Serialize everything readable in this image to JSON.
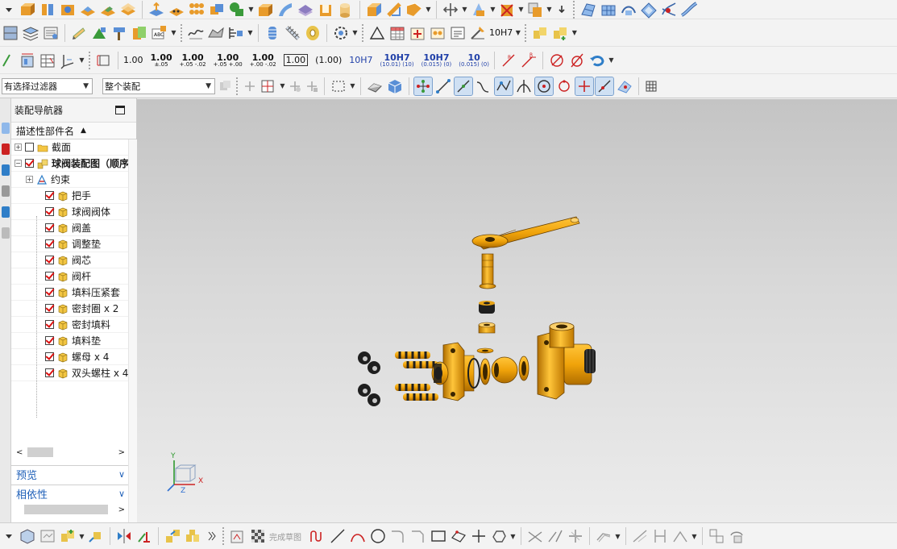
{
  "filters": {
    "selection_filter": "有选择过滤器",
    "scope": "整个装配"
  },
  "tolerances": [
    {
      "main": "1.00",
      "sub": "",
      "style": "plain"
    },
    {
      "main": "1.00",
      "sub": "±.05",
      "style": "stack"
    },
    {
      "main": "1.00",
      "sub": "+.05 -.02",
      "style": "stack"
    },
    {
      "main": "1.00",
      "sub": "+.05 +.00",
      "style": "stack"
    },
    {
      "main": "1.00",
      "sub": "+.00 -.02",
      "style": "stack"
    },
    {
      "main": "1.00",
      "sub": "",
      "style": "boxed"
    },
    {
      "main": "(1.00)",
      "sub": "",
      "style": "plain"
    },
    {
      "main": "10H7",
      "sub": "",
      "style": "blue"
    },
    {
      "main": "10H7",
      "sub": "(10.01) (10)",
      "style": "bluestack"
    },
    {
      "main": "10H7",
      "sub": "(0.015) (0)",
      "style": "bluestack"
    },
    {
      "main": "10",
      "sub": "(0.015) (0)",
      "style": "bluestack"
    }
  ],
  "fit_dropdown_label": "10H7",
  "navigator": {
    "title": "装配导航器",
    "column_header": "描述性部件名",
    "nodes": [
      {
        "label": "截面",
        "expander": "+",
        "checked": false,
        "icon": "folder-icon",
        "indent": 0
      },
      {
        "label": "球阀装配图（顺序",
        "expander": "−",
        "checked": true,
        "icon": "assembly-icon",
        "indent": 0,
        "bold": true
      },
      {
        "label": "约束",
        "expander": "+",
        "checked": null,
        "icon": "constraint-icon",
        "indent": 1
      },
      {
        "label": "把手",
        "checked": true,
        "icon": "part-cube-icon",
        "indent": 2
      },
      {
        "label": "球阀阀体",
        "checked": true,
        "icon": "part-cube-icon",
        "indent": 2
      },
      {
        "label": "阀盖",
        "checked": true,
        "icon": "part-cube-icon",
        "indent": 2
      },
      {
        "label": "调整垫",
        "checked": true,
        "icon": "part-cube-icon",
        "indent": 2
      },
      {
        "label": "阀芯",
        "checked": true,
        "icon": "part-cube-icon",
        "indent": 2
      },
      {
        "label": "阀杆",
        "checked": true,
        "icon": "part-cube-icon",
        "indent": 2
      },
      {
        "label": "填料压紧套",
        "checked": true,
        "icon": "part-cube-icon",
        "indent": 2
      },
      {
        "label": "密封圈 x 2",
        "checked": true,
        "icon": "part-cube-icon",
        "indent": 2
      },
      {
        "label": "密封填料",
        "checked": true,
        "icon": "part-cube-icon",
        "indent": 2
      },
      {
        "label": "填料垫",
        "checked": true,
        "icon": "part-cube-icon",
        "indent": 2
      },
      {
        "label": "螺母 x 4",
        "checked": true,
        "icon": "part-cube-icon",
        "indent": 2
      },
      {
        "label": "双头螺柱 x 4",
        "checked": true,
        "icon": "part-cube-icon",
        "indent": 2
      }
    ],
    "sections": {
      "preview": "预览",
      "dependency": "相依性"
    }
  },
  "triad": {
    "x": "X",
    "y": "Y",
    "z": "Z"
  },
  "bottom_toolbar": {
    "finish_sketch": "完成草图"
  },
  "colors": {
    "part_orange": "#f0a30a",
    "part_dark": "#1f1f1f",
    "check_red": "#d11111",
    "section_blue": "#1e5fb8"
  }
}
